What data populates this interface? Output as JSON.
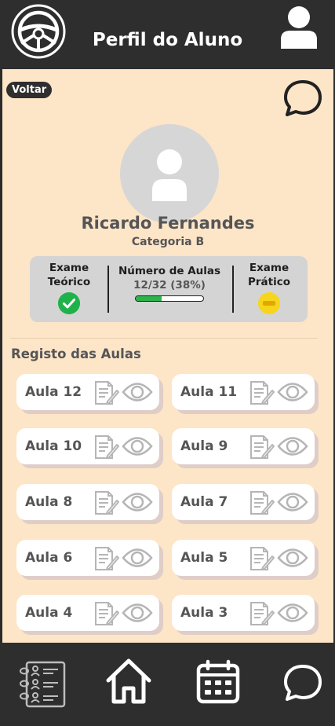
{
  "header": {
    "title": "Perfil do Aluno",
    "logo_icon": "steering-wheel-icon",
    "user_icon": "user-icon"
  },
  "main": {
    "back_label": "Voltar",
    "chat_icon": "chat-bubble-icon"
  },
  "profile": {
    "name": "Ricardo Fernandes",
    "category": "Categoria B",
    "avatar_icon": "person-icon"
  },
  "stats": {
    "theory_label": "Exame Teórico",
    "theory_status": "passed",
    "theory_icon": "check-icon",
    "lessons_label": "Número de Aulas",
    "lessons_value": "12/32 (38%)",
    "lessons_progress": 0.38,
    "practical_label": "Exame Prático",
    "practical_status": "pending",
    "practical_icon": "pending-icon"
  },
  "lessons": {
    "title": "Registo das Aulas",
    "items": [
      {
        "label": "Aula 12"
      },
      {
        "label": "Aula 11"
      },
      {
        "label": "Aula 10"
      },
      {
        "label": "Aula 9"
      },
      {
        "label": "Aula 8"
      },
      {
        "label": "Aula 7"
      },
      {
        "label": "Aula 6"
      },
      {
        "label": "Aula 5"
      },
      {
        "label": "Aula 4"
      },
      {
        "label": "Aula 3"
      }
    ]
  },
  "footer": {
    "icons": [
      "student-list-icon",
      "home-icon",
      "calendar-icon",
      "chat-bubble-icon"
    ]
  },
  "colors": {
    "header_bg": "#2e2e2e",
    "page_bg": "#fde5c8",
    "card_bg": "#ffffff",
    "passed": "#1fb24a",
    "pending": "#f7d51d",
    "progress": "#2db34a"
  }
}
